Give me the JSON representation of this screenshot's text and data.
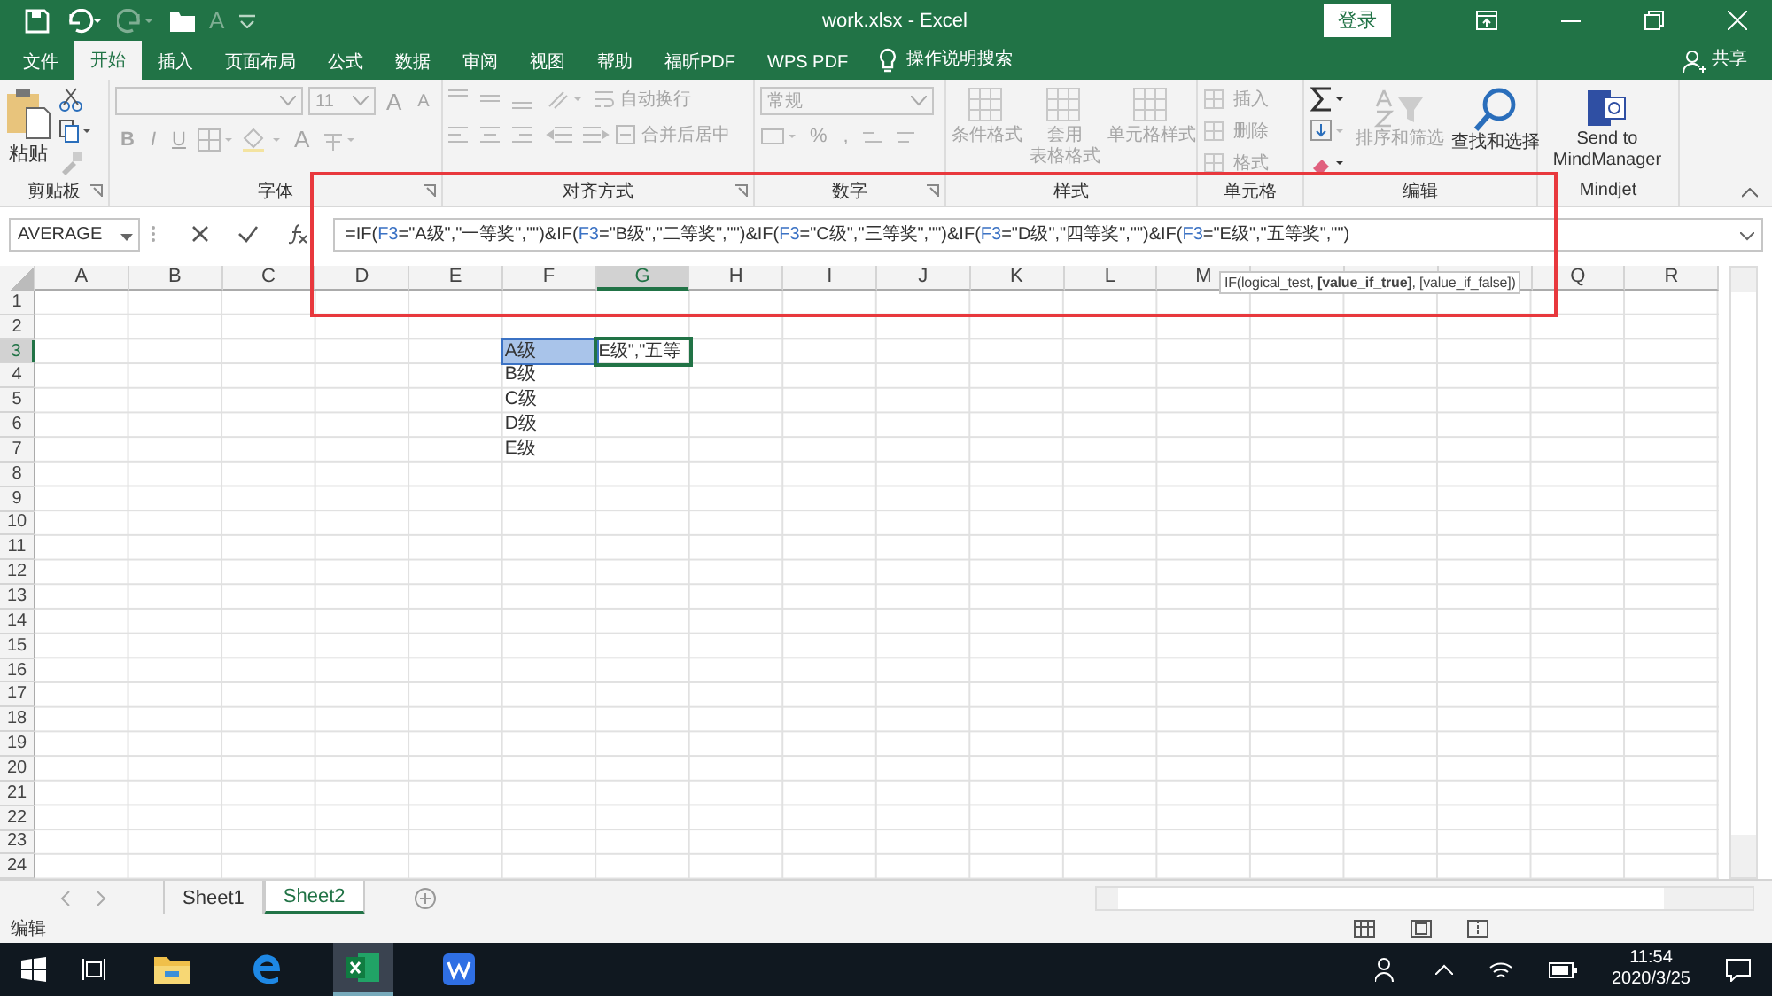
{
  "title_bar": {
    "qat_font_color": "A",
    "title": "work.xlsx  -  Excel",
    "login": "登录"
  },
  "menu_tabs": [
    {
      "label": "文件",
      "selected": false
    },
    {
      "label": "开始",
      "selected": true
    },
    {
      "label": "插入",
      "selected": false
    },
    {
      "label": "页面布局",
      "selected": false
    },
    {
      "label": "公式",
      "selected": false
    },
    {
      "label": "数据",
      "selected": false
    },
    {
      "label": "审阅",
      "selected": false
    },
    {
      "label": "视图",
      "selected": false
    },
    {
      "label": "帮助",
      "selected": false
    },
    {
      "label": "福昕PDF",
      "selected": false
    },
    {
      "label": "WPS PDF",
      "selected": false
    }
  ],
  "tell_me": "操作说明搜索",
  "share": "共享",
  "ribbon": {
    "clipboard": {
      "label": "剪贴板",
      "paste": "粘贴",
      "disabled": false
    },
    "font": {
      "label": "字体",
      "disabled": true,
      "size": "11",
      "grow": "A",
      "shrink": "A",
      "bold": "B",
      "italic": "I",
      "underline": "U",
      "font_color": "A"
    },
    "alignment": {
      "label": "对齐方式",
      "disabled": true,
      "wrap": "自动换行",
      "merge": "合并后居中"
    },
    "number": {
      "label": "数字",
      "disabled": true,
      "format": "常规",
      "percent": "%",
      "comma": ","
    },
    "styles": {
      "label": "样式",
      "disabled": true,
      "buttons": [
        {
          "lines": [
            "条件格式"
          ]
        },
        {
          "lines": [
            "套用",
            "表格格式"
          ]
        },
        {
          "lines": [
            "单元格样式"
          ]
        }
      ]
    },
    "cells": {
      "label": "单元格",
      "disabled": true,
      "buttons": [
        "插入",
        "删除",
        "格式"
      ]
    },
    "editing": {
      "label": "编辑",
      "sort": {
        "label": "排序和筛选",
        "disabled": true
      },
      "find": {
        "label": "查找和选择",
        "disabled": false
      }
    },
    "mindjet": {
      "label": "Mindjet",
      "send": "Send to MindManager"
    }
  },
  "formula_bar": {
    "name_box": "AVERAGE",
    "formula": [
      {
        "text": "=IF(",
        "ref": false
      },
      {
        "text": "F3",
        "ref": true
      },
      {
        "text": "=\"A级\",\"一等奖\",\"\")&IF(",
        "ref": false
      },
      {
        "text": "F3",
        "ref": true
      },
      {
        "text": "=\"B级\",\"二等奖\",\"\")&IF(",
        "ref": false
      },
      {
        "text": "F3",
        "ref": true
      },
      {
        "text": "=\"C级\",\"三等奖\",\"\")&IF(",
        "ref": false
      },
      {
        "text": "F3",
        "ref": true
      },
      {
        "text": "=\"D级\",\"四等奖\",\"\")&IF(",
        "ref": false
      },
      {
        "text": "F3",
        "ref": true
      },
      {
        "text": "=\"E级\",\"五等奖\",\"\")",
        "ref": false
      }
    ]
  },
  "tooltip": "IF(logical_test, **[value_if_true]**, [value_if_false])",
  "columns": [
    {
      "label": "A",
      "selected": false
    },
    {
      "label": "B",
      "selected": false
    },
    {
      "label": "C",
      "selected": false
    },
    {
      "label": "D",
      "selected": false
    },
    {
      "label": "E",
      "selected": false
    },
    {
      "label": "F",
      "selected": false
    },
    {
      "label": "G",
      "selected": true
    },
    {
      "label": "H",
      "selected": false
    },
    {
      "label": "I",
      "selected": false
    },
    {
      "label": "J",
      "selected": false
    },
    {
      "label": "K",
      "selected": false
    },
    {
      "label": "L",
      "selected": false
    },
    {
      "label": "M",
      "selected": false
    },
    {
      "selected": false
    },
    {
      "selected": false
    },
    {
      "selected": false
    },
    {
      "label": "Q",
      "selected": false
    },
    {
      "label": "R",
      "selected": false
    }
  ],
  "rows": [
    {
      "header": "1",
      "selected": false
    },
    {
      "header": "2",
      "selected": false
    },
    {
      "header": "3",
      "selected": true,
      "cells": [
        null,
        null,
        null,
        null,
        null,
        {
          "value": "A级",
          "highlighted": true,
          "active": false
        },
        {
          "value": "E级\",\"五等",
          "highlighted": false,
          "active": true
        }
      ]
    },
    {
      "header": "4",
      "selected": false,
      "cells": [
        null,
        null,
        null,
        null,
        null,
        {
          "value": "B级",
          "highlighted": false,
          "active": false
        }
      ]
    },
    {
      "header": "5",
      "selected": false,
      "cells": [
        null,
        null,
        null,
        null,
        null,
        {
          "value": "C级",
          "highlighted": false,
          "active": false
        }
      ]
    },
    {
      "header": "6",
      "selected": false,
      "cells": [
        null,
        null,
        null,
        null,
        null,
        {
          "value": "D级",
          "highlighted": false,
          "active": false
        }
      ]
    },
    {
      "header": "7",
      "selected": false,
      "cells": [
        null,
        null,
        null,
        null,
        null,
        {
          "value": "E级",
          "highlighted": false,
          "active": false
        }
      ]
    },
    {
      "header": "8",
      "selected": false
    },
    {
      "header": "9",
      "selected": false
    },
    {
      "header": "10",
      "selected": false
    },
    {
      "header": "11",
      "selected": false
    },
    {
      "header": "12",
      "selected": false
    },
    {
      "header": "13",
      "selected": false
    },
    {
      "header": "14",
      "selected": false
    },
    {
      "header": "15",
      "selected": false
    },
    {
      "header": "16",
      "selected": false
    },
    {
      "header": "17",
      "selected": false
    },
    {
      "header": "18",
      "selected": false
    },
    {
      "header": "19",
      "selected": false
    },
    {
      "header": "20",
      "selected": false
    },
    {
      "header": "21",
      "selected": false
    },
    {
      "header": "22",
      "selected": false
    },
    {
      "header": "23",
      "selected": false
    },
    {
      "header": "24",
      "selected": false
    }
  ],
  "sheet_tabs": [
    {
      "label": "Sheet1",
      "selected": false
    },
    {
      "label": "Sheet2",
      "selected": true
    }
  ],
  "status_bar": {
    "mode": "编辑"
  },
  "taskbar": {
    "apps": [
      {
        "kind": "explorer",
        "active": false
      },
      {
        "kind": "edge",
        "active": false
      },
      {
        "kind": "excel",
        "active": true
      },
      {
        "kind": "wps",
        "active": false
      }
    ],
    "time": "11:54",
    "date": "2020/3/25"
  }
}
